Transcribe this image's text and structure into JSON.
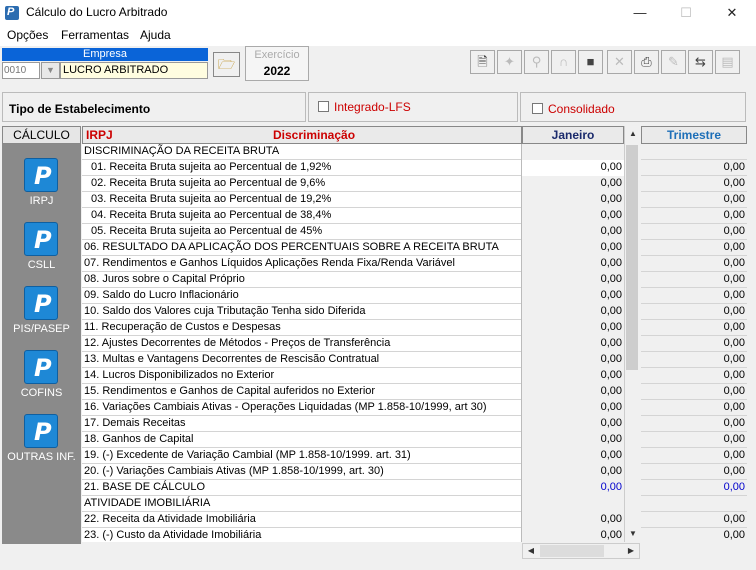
{
  "window": {
    "title": "Cálculo do Lucro Arbitrado",
    "minimize": "—",
    "maximize": "☐",
    "close": "✕"
  },
  "menu": [
    "Opções",
    "Ferramentas",
    "Ajuda"
  ],
  "empresa": {
    "label": "Empresa",
    "code": "0010",
    "name": "LUCRO ARBITRADO"
  },
  "exercicio": {
    "label": "Exercício",
    "value": "2022"
  },
  "toolbar_icons": [
    "new-document-icon",
    "settings-icon",
    "zoom-icon",
    "magnet-icon",
    "save-icon",
    "delete-icon",
    "print-icon",
    "edit-icon",
    "import-icon",
    "preview-icon"
  ],
  "tipo_estabelecimento": {
    "label": "Tipo de Estabelecimento",
    "integrado_label": "Integrado-LFS",
    "consolidado_label": "Consolidado"
  },
  "left_panel": {
    "header": "CÁLCULO",
    "items": [
      "IRPJ",
      "CSLL",
      "PIS/PASEP",
      "COFINS",
      "OUTRAS INF."
    ]
  },
  "grid": {
    "col_tax": "IRPJ",
    "col_desc": "Discriminação",
    "col_month": "Janeiro",
    "col_quarter": "Trimestre",
    "rows": [
      {
        "desc": "DISCRIMINAÇÃO DA RECEITA BRUTA",
        "val": "",
        "tri": "",
        "sub": false
      },
      {
        "desc": "01. Receita Bruta sujeita ao Percentual de 1,92%",
        "val": "0,00",
        "tri": "0,00",
        "sub": true
      },
      {
        "desc": "02. Receita Bruta sujeita ao Percentual de 9,6%",
        "val": "0,00",
        "tri": "0,00",
        "sub": true
      },
      {
        "desc": "03. Receita Bruta sujeita ao Percentual de 19,2%",
        "val": "0,00",
        "tri": "0,00",
        "sub": true
      },
      {
        "desc": "04. Receita Bruta sujeita ao Percentual de 38,4%",
        "val": "0,00",
        "tri": "0,00",
        "sub": true
      },
      {
        "desc": "05. Receita Bruta sujeita ao Percentual de 45%",
        "val": "0,00",
        "tri": "0,00",
        "sub": true
      },
      {
        "desc": "06. RESULTADO DA APLICAÇÃO DOS PERCENTUAIS SOBRE A RECEITA BRUTA",
        "val": "0,00",
        "tri": "0,00",
        "sub": false
      },
      {
        "desc": "07. Rendimentos e Ganhos Líquidos Aplicações Renda Fixa/Renda Variável",
        "val": "0,00",
        "tri": "0,00",
        "sub": false
      },
      {
        "desc": "08. Juros sobre o Capital Próprio",
        "val": "0,00",
        "tri": "0,00",
        "sub": false
      },
      {
        "desc": "09. Saldo do Lucro Inflacionário",
        "val": "0,00",
        "tri": "0,00",
        "sub": false
      },
      {
        "desc": "10. Saldo dos Valores cuja Tributação Tenha sido Diferida",
        "val": "0,00",
        "tri": "0,00",
        "sub": false
      },
      {
        "desc": "11. Recuperação de Custos e Despesas",
        "val": "0,00",
        "tri": "0,00",
        "sub": false
      },
      {
        "desc": "12. Ajustes Decorrentes de Métodos - Preços de Transferência",
        "val": "0,00",
        "tri": "0,00",
        "sub": false
      },
      {
        "desc": "13. Multas e Vantagens Decorrentes de Rescisão Contratual",
        "val": "0,00",
        "tri": "0,00",
        "sub": false
      },
      {
        "desc": "14. Lucros Disponibilizados no Exterior",
        "val": "0,00",
        "tri": "0,00",
        "sub": false
      },
      {
        "desc": "15. Rendimentos e Ganhos de Capital auferidos no Exterior",
        "val": "0,00",
        "tri": "0,00",
        "sub": false
      },
      {
        "desc": "16. Variações Cambiais Ativas - Operações Liquidadas (MP 1.858-10/1999, art 30)",
        "val": "0,00",
        "tri": "0,00",
        "sub": false
      },
      {
        "desc": "17. Demais Receitas",
        "val": "0,00",
        "tri": "0,00",
        "sub": false
      },
      {
        "desc": "18. Ganhos de Capital",
        "val": "0,00",
        "tri": "0,00",
        "sub": false
      },
      {
        "desc": "19. (-) Excedente de Variação Cambial (MP 1.858-10/1999. art. 31)",
        "val": "0,00",
        "tri": "0,00",
        "sub": false
      },
      {
        "desc": "20. (-) Variações Cambiais Ativas (MP 1.858-10/1999, art. 30)",
        "val": "0,00",
        "tri": "0,00",
        "sub": false
      },
      {
        "desc": "21. BASE DE CÁLCULO",
        "val": "0,00",
        "tri": "0,00",
        "sub": false,
        "blue": true
      },
      {
        "desc": "ATIVIDADE IMOBILIÁRIA",
        "val": "",
        "tri": "",
        "sub": false
      },
      {
        "desc": "22. Receita da Atividade Imobiliária",
        "val": "0,00",
        "tri": "0,00",
        "sub": false
      },
      {
        "desc": "23. (-) Custo da Atividade Imobiliária",
        "val": "0,00",
        "tri": "0,00",
        "sub": false
      }
    ]
  },
  "colors": {
    "accent_blue": "#0a64d8",
    "red_header": "#cc0000",
    "quarter_header": "#1e6fb8",
    "base_value": "#0000cc"
  }
}
